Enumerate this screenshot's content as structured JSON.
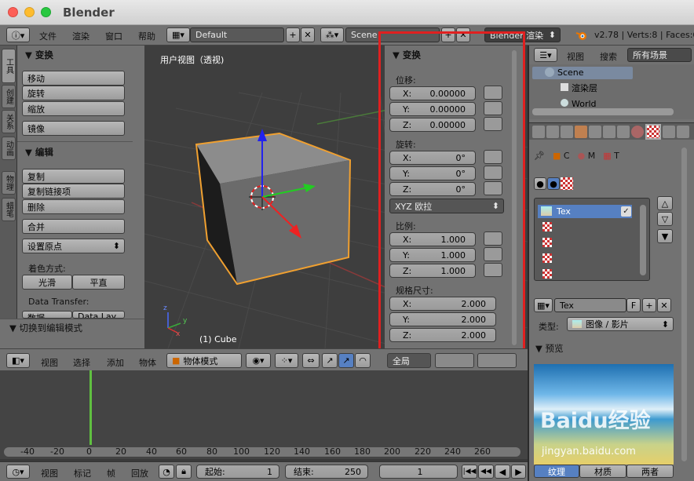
{
  "app": {
    "title": "Blender"
  },
  "infobar": {
    "menus": [
      "文件",
      "渲染",
      "窗口",
      "帮助"
    ],
    "layout": "Default",
    "scene": "Scene",
    "engine": "Blender 渲染",
    "stats": "v2.78 | Verts:8 | Faces:6"
  },
  "toolshelf": {
    "tabs": [
      "工具",
      "创建",
      "关系",
      "动画",
      "物理",
      "蜡笔"
    ],
    "transform": {
      "title": "变换",
      "buttons": [
        "移动",
        "旋转",
        "缩放",
        "镜像"
      ]
    },
    "edit": {
      "title": "编辑",
      "buttons": [
        "复制",
        "复制链接项",
        "删除",
        "合并"
      ],
      "origin": "设置原点"
    },
    "shading": {
      "label": "着色方式:",
      "smooth": "光滑",
      "flat": "平直"
    },
    "data_transfer": {
      "label": "Data Transfer:",
      "data": "数据",
      "layout": "Data Lay"
    },
    "toggle_edit": "切换到编辑模式"
  },
  "viewport": {
    "title": "用户视图（透视)",
    "object": "(1) Cube",
    "axis_x": "x",
    "axis_y": "y",
    "axis_z": "z"
  },
  "npanel": {
    "title": "变换",
    "location": {
      "label": "位移:",
      "x": "0.00000",
      "y": "0.00000",
      "z": "0.00000"
    },
    "rotation": {
      "label": "旋转:",
      "x": "0°",
      "y": "0°",
      "z": "0°",
      "mode": "XYZ 欧拉"
    },
    "scale": {
      "label": "比例:",
      "x": "1.000",
      "y": "1.000",
      "z": "1.000"
    },
    "dimensions": {
      "label": "规格尺寸:",
      "x": "2.000",
      "y": "2.000",
      "z": "2.000"
    },
    "axis_labels": {
      "x": "X:",
      "y": "Y:",
      "z": "Z:"
    }
  },
  "header3d": {
    "menus": [
      "视图",
      "选择",
      "添加",
      "物体"
    ],
    "mode": "物体模式",
    "orientation": "全局"
  },
  "timeline": {
    "ticks": [
      "-40",
      "-20",
      "0",
      "20",
      "40",
      "60",
      "80",
      "100",
      "120",
      "140",
      "160",
      "180",
      "200",
      "220",
      "240",
      "260"
    ],
    "menus": [
      "视图",
      "标记",
      "帧",
      "回放"
    ],
    "start_label": "起始:",
    "start": "1",
    "end_label": "结束:",
    "end": "250",
    "current": "1"
  },
  "outliner": {
    "view": "视图",
    "search": "搜索",
    "filter": "所有场景",
    "scene": "Scene",
    "renderlayer": "渲染层",
    "world": "World"
  },
  "properties": {
    "context": {
      "c": "C",
      "m": "M",
      "t": "T"
    },
    "slot": "Tex",
    "texture_name": "Tex",
    "users": "F",
    "type_label": "类型:",
    "type_value": "图像 / 影片",
    "preview": "预览",
    "bottom_tabs": [
      "纹理",
      "材质",
      "两者"
    ]
  },
  "watermark": {
    "brand": "Baidu经验",
    "url": "jingyan.baidu.com"
  },
  "colors": {
    "highlight_box": "#e02020",
    "select_orange": "#f0a030",
    "playhead": "#60c040"
  }
}
